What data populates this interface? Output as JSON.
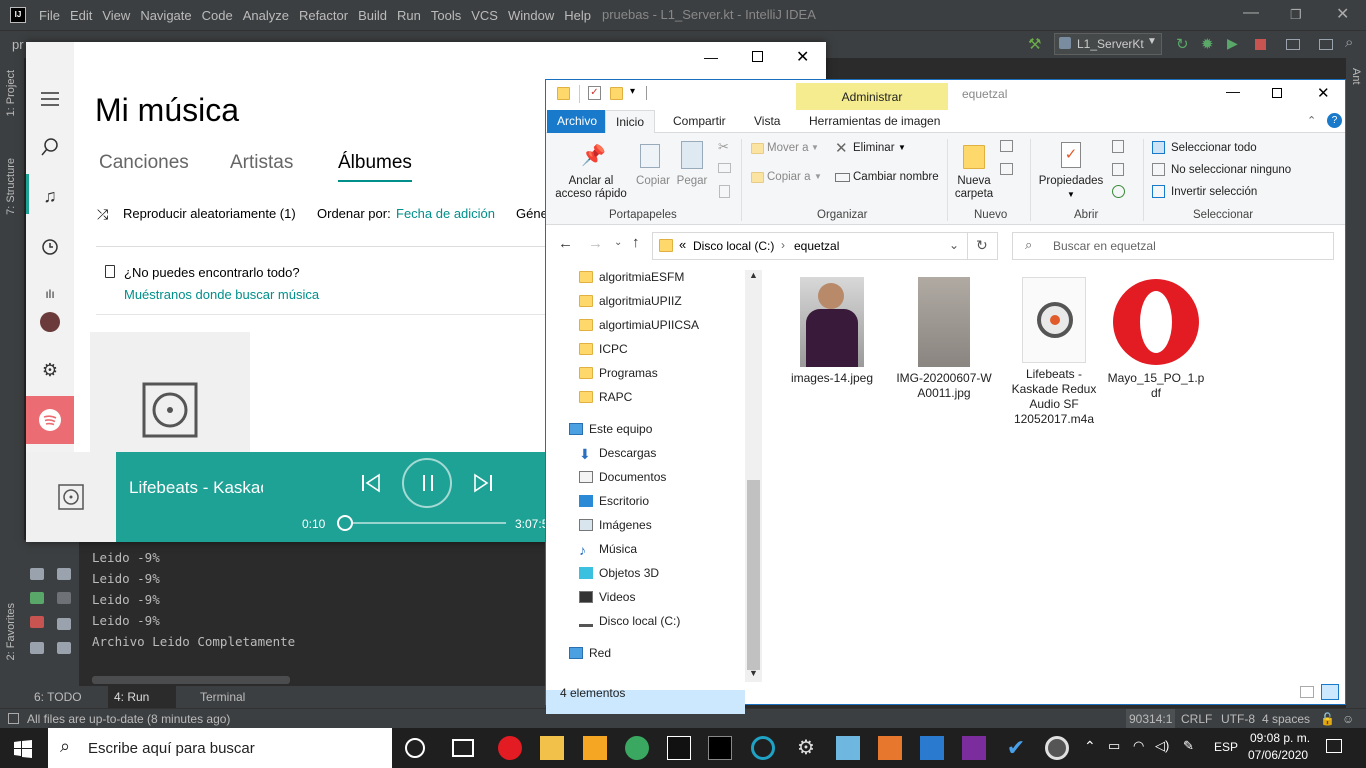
{
  "intellij": {
    "logo": "IJ",
    "menu": [
      "File",
      "Edit",
      "View",
      "Navigate",
      "Code",
      "Analyze",
      "Refactor",
      "Build",
      "Run",
      "Tools",
      "VCS",
      "Window",
      "Help"
    ],
    "title": "pruebas - L1_Server.kt - IntelliJ IDEA",
    "project_label": "pr",
    "file_tab": "L1_ServerKt",
    "run_config": "L1_ServerKt",
    "left_tabs": [
      "1: Project",
      "7: Structure",
      "2: Favorites"
    ],
    "right_tabs": [
      "Ant"
    ],
    "console": [
      "Leido -9%",
      "Leido -9%",
      "Leido -9%",
      "Leido -9%",
      "Archivo Leido Completamente"
    ],
    "bottom_tabs": [
      "6: TODO",
      "4: Run",
      "Terminal"
    ],
    "status": "All files are up-to-date (8 minutes ago)",
    "status_right": {
      "pos": "90314:1",
      "eol": "CRLF",
      "enc": "UTF-8",
      "indent": "4 spaces"
    }
  },
  "music": {
    "title": "Mi música",
    "tabs": [
      "Canciones",
      "Artistas",
      "Álbumes"
    ],
    "shuffle": "Reproducir aleatoriamente (1)",
    "sort_label": "Ordenar por:",
    "sort_value": "Fecha de adición",
    "genre_cut": "Géne",
    "not_found": "¿No puedes encontrarlo todo?",
    "show_where": "Muéstranos donde buscar música",
    "now_playing": "Lifebeats - Kaskade",
    "elapsed": "0:10",
    "duration": "3:07:5",
    "progress": 0.003
  },
  "explorer": {
    "context_tab": "Administrar",
    "title": "equetzal",
    "tabs": [
      "Archivo",
      "Inicio",
      "Compartir",
      "Vista",
      "Herramientas de imagen"
    ],
    "ribbon": {
      "pin": [
        "Anclar al",
        "acceso rápido"
      ],
      "copy": "Copiar",
      "paste": "Pegar",
      "move": "Mover a",
      "copy_to": "Copiar a",
      "delete": "Eliminar",
      "rename": "Cambiar nombre",
      "new_folder": [
        "Nueva",
        "carpeta"
      ],
      "properties": "Propiedades",
      "select_all": "Seleccionar todo",
      "select_none": "No seleccionar ninguno",
      "invert": "Invertir selección",
      "groups": [
        "Portapapeles",
        "Organizar",
        "Nuevo",
        "Abrir",
        "Seleccionar"
      ]
    },
    "address": {
      "prefix": "«",
      "drive": "Disco local (C:)",
      "sep": "›",
      "folder": "equetzal"
    },
    "search_placeholder": "Buscar en equetzal",
    "nav": {
      "folders": [
        "algoritmiaESFM",
        "algoritmiaUPIIZ",
        "algortimiaUPIICSA",
        "ICPC",
        "Programas",
        "RAPC"
      ],
      "this_pc": "Este equipo",
      "pc_items": [
        "Descargas",
        "Documentos",
        "Escritorio",
        "Imágenes",
        "Música",
        "Objetos 3D",
        "Videos",
        "Disco local (C:)"
      ],
      "network": "Red"
    },
    "files": [
      {
        "name": "images-14.jpeg",
        "lines": [
          "images-14.jpeg"
        ]
      },
      {
        "name": "IMG-20200607-WA0011.jpg",
        "lines": [
          "IMG-20200607-W",
          "A0011.jpg"
        ]
      },
      {
        "name": "Lifebeats - Kaskade Redux Audio SF 12052017.m4a",
        "lines": [
          "Lifebeats -",
          "Kaskade   Redux",
          "Audio SF",
          "12052017.m4a"
        ]
      },
      {
        "name": "Mayo_15_PO_1.pdf",
        "lines": [
          "Mayo_15_PO_1.p",
          "df"
        ]
      }
    ],
    "status": "4 elementos"
  },
  "taskbar": {
    "search_placeholder": "Escribe aquí para buscar",
    "lang": "ESP",
    "time": "09:08 p. m.",
    "date": "07/06/2020"
  },
  "colors": {
    "accent_teal": "#1ea295",
    "explorer_blue": "#1979ca",
    "ide_bg": "#2b2b2b"
  }
}
